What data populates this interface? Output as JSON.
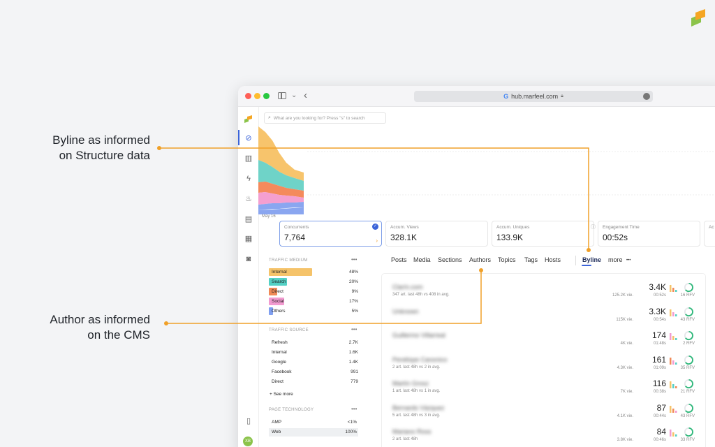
{
  "callouts": {
    "byline_line1": "Byline as informed",
    "byline_line2": "on Structure data",
    "author_line1": "Author as informed",
    "author_line2": "on the CMS"
  },
  "browser": {
    "url": "hub.marfeel.com"
  },
  "search": {
    "placeholder": "What are you looking for? Press \"s\" to search"
  },
  "chart_data": {
    "type": "area",
    "x_label": "May 16",
    "series_colors": [
      "#f7c46c",
      "#6fd3c8",
      "#f48a5c",
      "#f49fd0",
      "#8aa6f0"
    ]
  },
  "kpis": [
    {
      "label": "Concurrents",
      "value": "7,764"
    },
    {
      "label": "Accum. Views",
      "value": "328.1K"
    },
    {
      "label": "Accum. Uniques",
      "value": "133.9K"
    },
    {
      "label": "Engagement Time",
      "value": "00:52s"
    },
    {
      "label": "Ac",
      "value": ""
    }
  ],
  "traffic_medium": {
    "title": "TRAFFIC MEDIUM",
    "more": "•••",
    "rows": [
      {
        "label": "Internal",
        "value": "48%",
        "pct": 48,
        "color": "#f5c36a"
      },
      {
        "label": "Search",
        "value": "20%",
        "pct": 20,
        "color": "#54d1c5"
      },
      {
        "label": "Direct",
        "value": "9%",
        "pct": 9,
        "color": "#f08a57"
      },
      {
        "label": "Social",
        "value": "17%",
        "pct": 17,
        "color": "#f29bd0"
      },
      {
        "label": "Others",
        "value": "5%",
        "pct": 5,
        "color": "#7f9ff0"
      }
    ]
  },
  "traffic_source": {
    "title": "TRAFFIC SOURCE",
    "more": "•••",
    "rows": [
      {
        "label": "Refresh",
        "value": "2.7K"
      },
      {
        "label": "Internal",
        "value": "1.6K"
      },
      {
        "label": "Google",
        "value": "1.4K"
      },
      {
        "label": "Facebook",
        "value": "991"
      },
      {
        "label": "Direct",
        "value": "779"
      }
    ],
    "see_more": "+ See more"
  },
  "page_technology": {
    "title": "PAGE TECHNOLOGY",
    "more": "•••",
    "rows": [
      {
        "label": "AMP",
        "value": "<1%"
      },
      {
        "label": "Web",
        "value": "100%"
      }
    ]
  },
  "tabs": [
    "Posts",
    "Media",
    "Sections",
    "Authors",
    "Topics",
    "Tags",
    "Hosts",
    "Byline",
    "more"
  ],
  "tab_more_icon": "•••",
  "active_tab": "Byline",
  "rows": [
    {
      "name": "Clarín.com",
      "sub": "347 art. last 48h vs 408 in avg.",
      "views": "125.2K vie.",
      "main": "3.4K",
      "time": "00:52s",
      "rfv": "16 RFV"
    },
    {
      "name": "Unknown",
      "sub": "",
      "views": "115K vie.",
      "main": "3.3K",
      "time": "00:54s",
      "rfv": "43 RFV"
    },
    {
      "name": "Guillermo Villarreal",
      "sub": "",
      "views": "4K vie.",
      "main": "174",
      "time": "01:48s",
      "rfv": "2 RFV"
    },
    {
      "name": "Penélope Canonico",
      "sub": "2 art. last 48h vs 2 in avg.",
      "views": "4.3K vie.",
      "main": "161",
      "time": "01:09s",
      "rfv": "35 RFV"
    },
    {
      "name": "Martín Grosz",
      "sub": "1 art. last 48h vs 1 in avg.",
      "views": "7K vie.",
      "main": "116",
      "time": "00:38s",
      "rfv": "21 RFV"
    },
    {
      "name": "Bernardo Vázquez",
      "sub": "5 art. last 48h vs 3 in avg.",
      "views": "4.1K vie.",
      "main": "87",
      "time": "00:44s",
      "rfv": "43 RFV"
    },
    {
      "name": "Mariano Ross",
      "sub": "2 art. last 48h",
      "views": "3.8K vie.",
      "main": "84",
      "time": "00:46s",
      "rfv": "33 RFV"
    }
  ],
  "user": {
    "initials": "XB"
  }
}
